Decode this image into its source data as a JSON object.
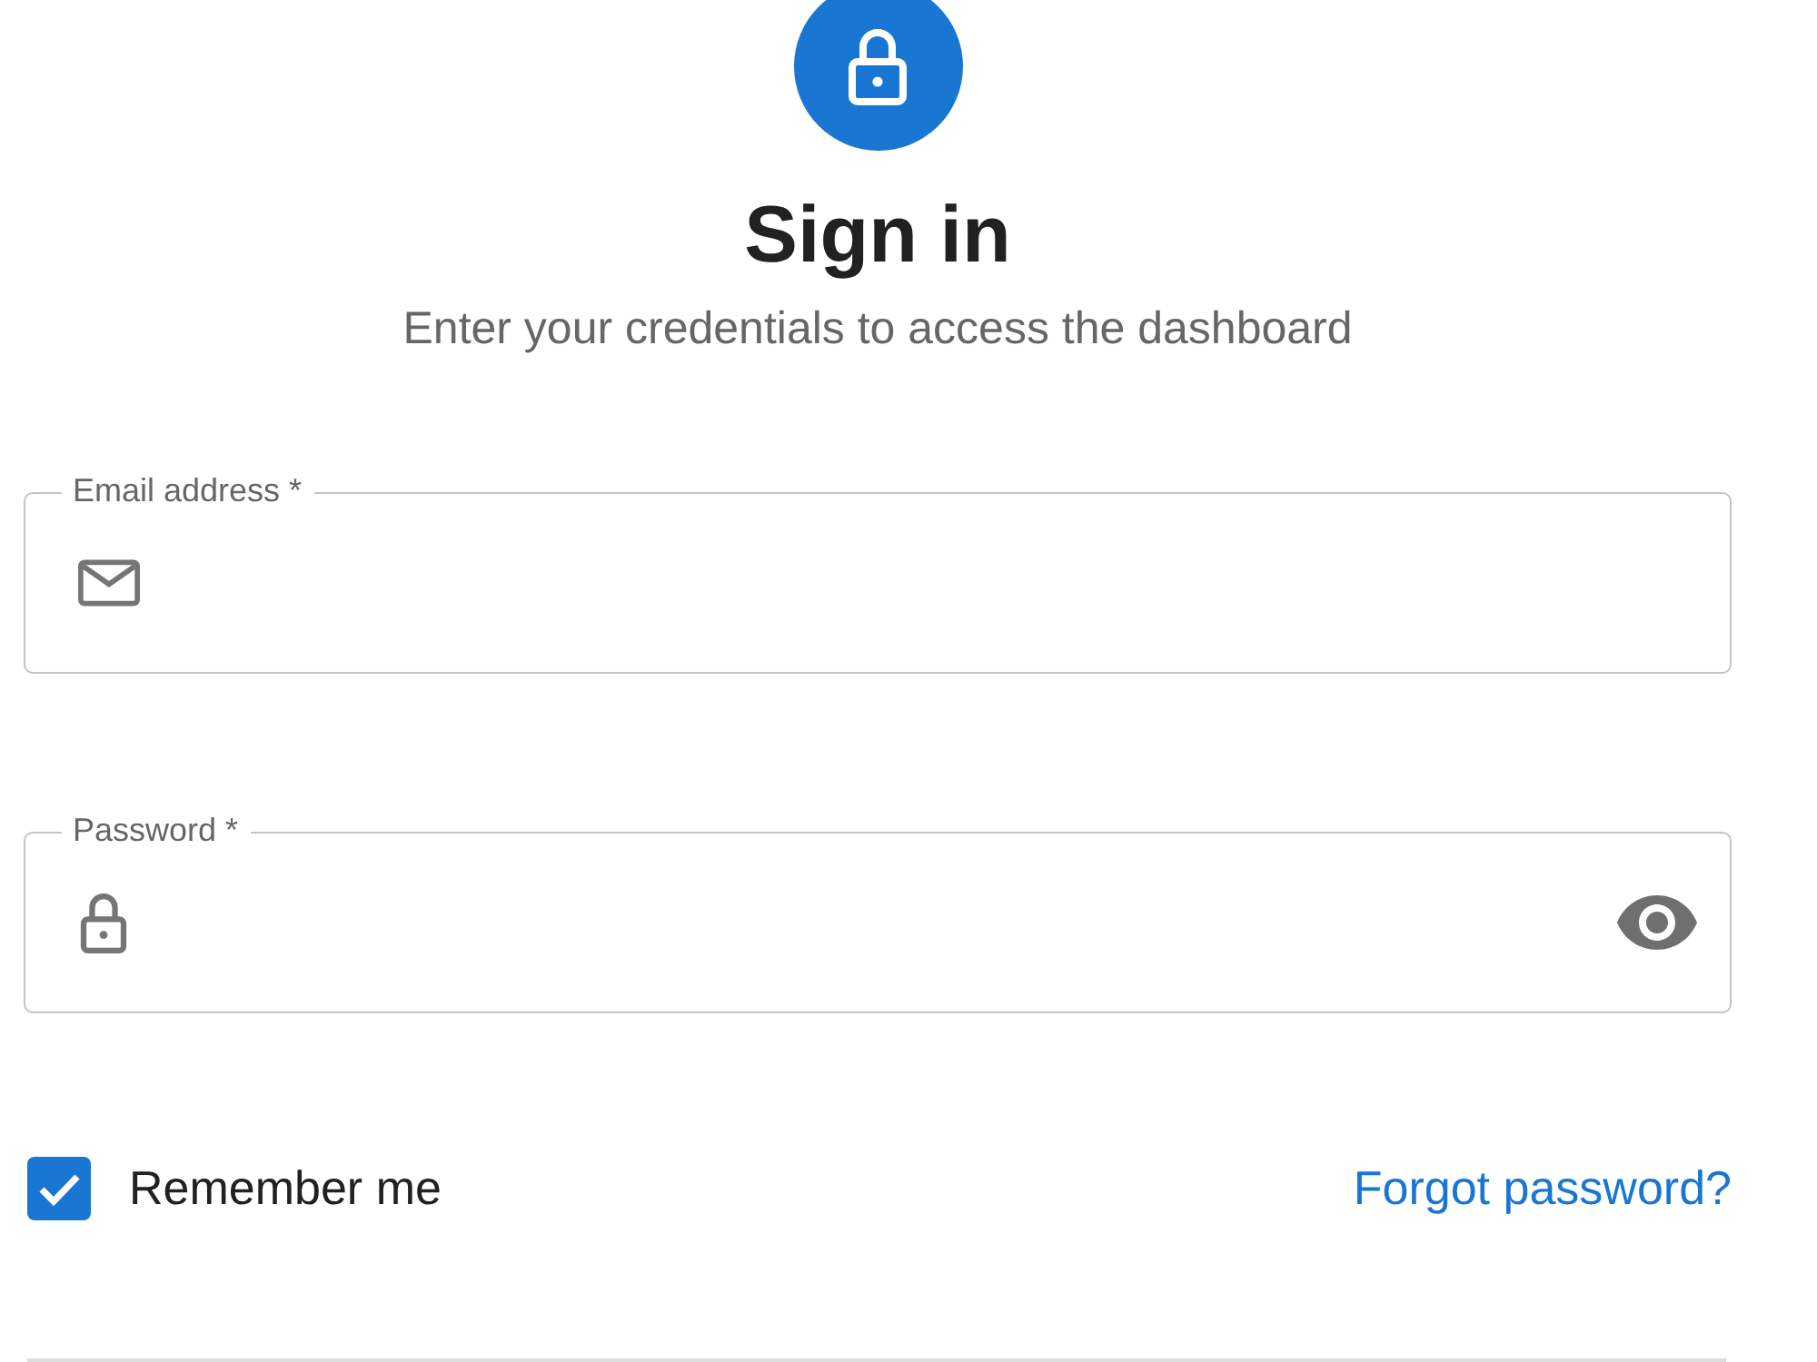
{
  "header": {
    "title": "Sign in",
    "subtitle": "Enter your credentials to access the dashboard"
  },
  "fields": [
    {
      "kind": "email",
      "label": "Email address *"
    },
    {
      "kind": "password",
      "label": "Password *"
    }
  ],
  "remember": {
    "label": "Remember me",
    "checked": true
  },
  "forgot_link": "Forgot password?"
}
